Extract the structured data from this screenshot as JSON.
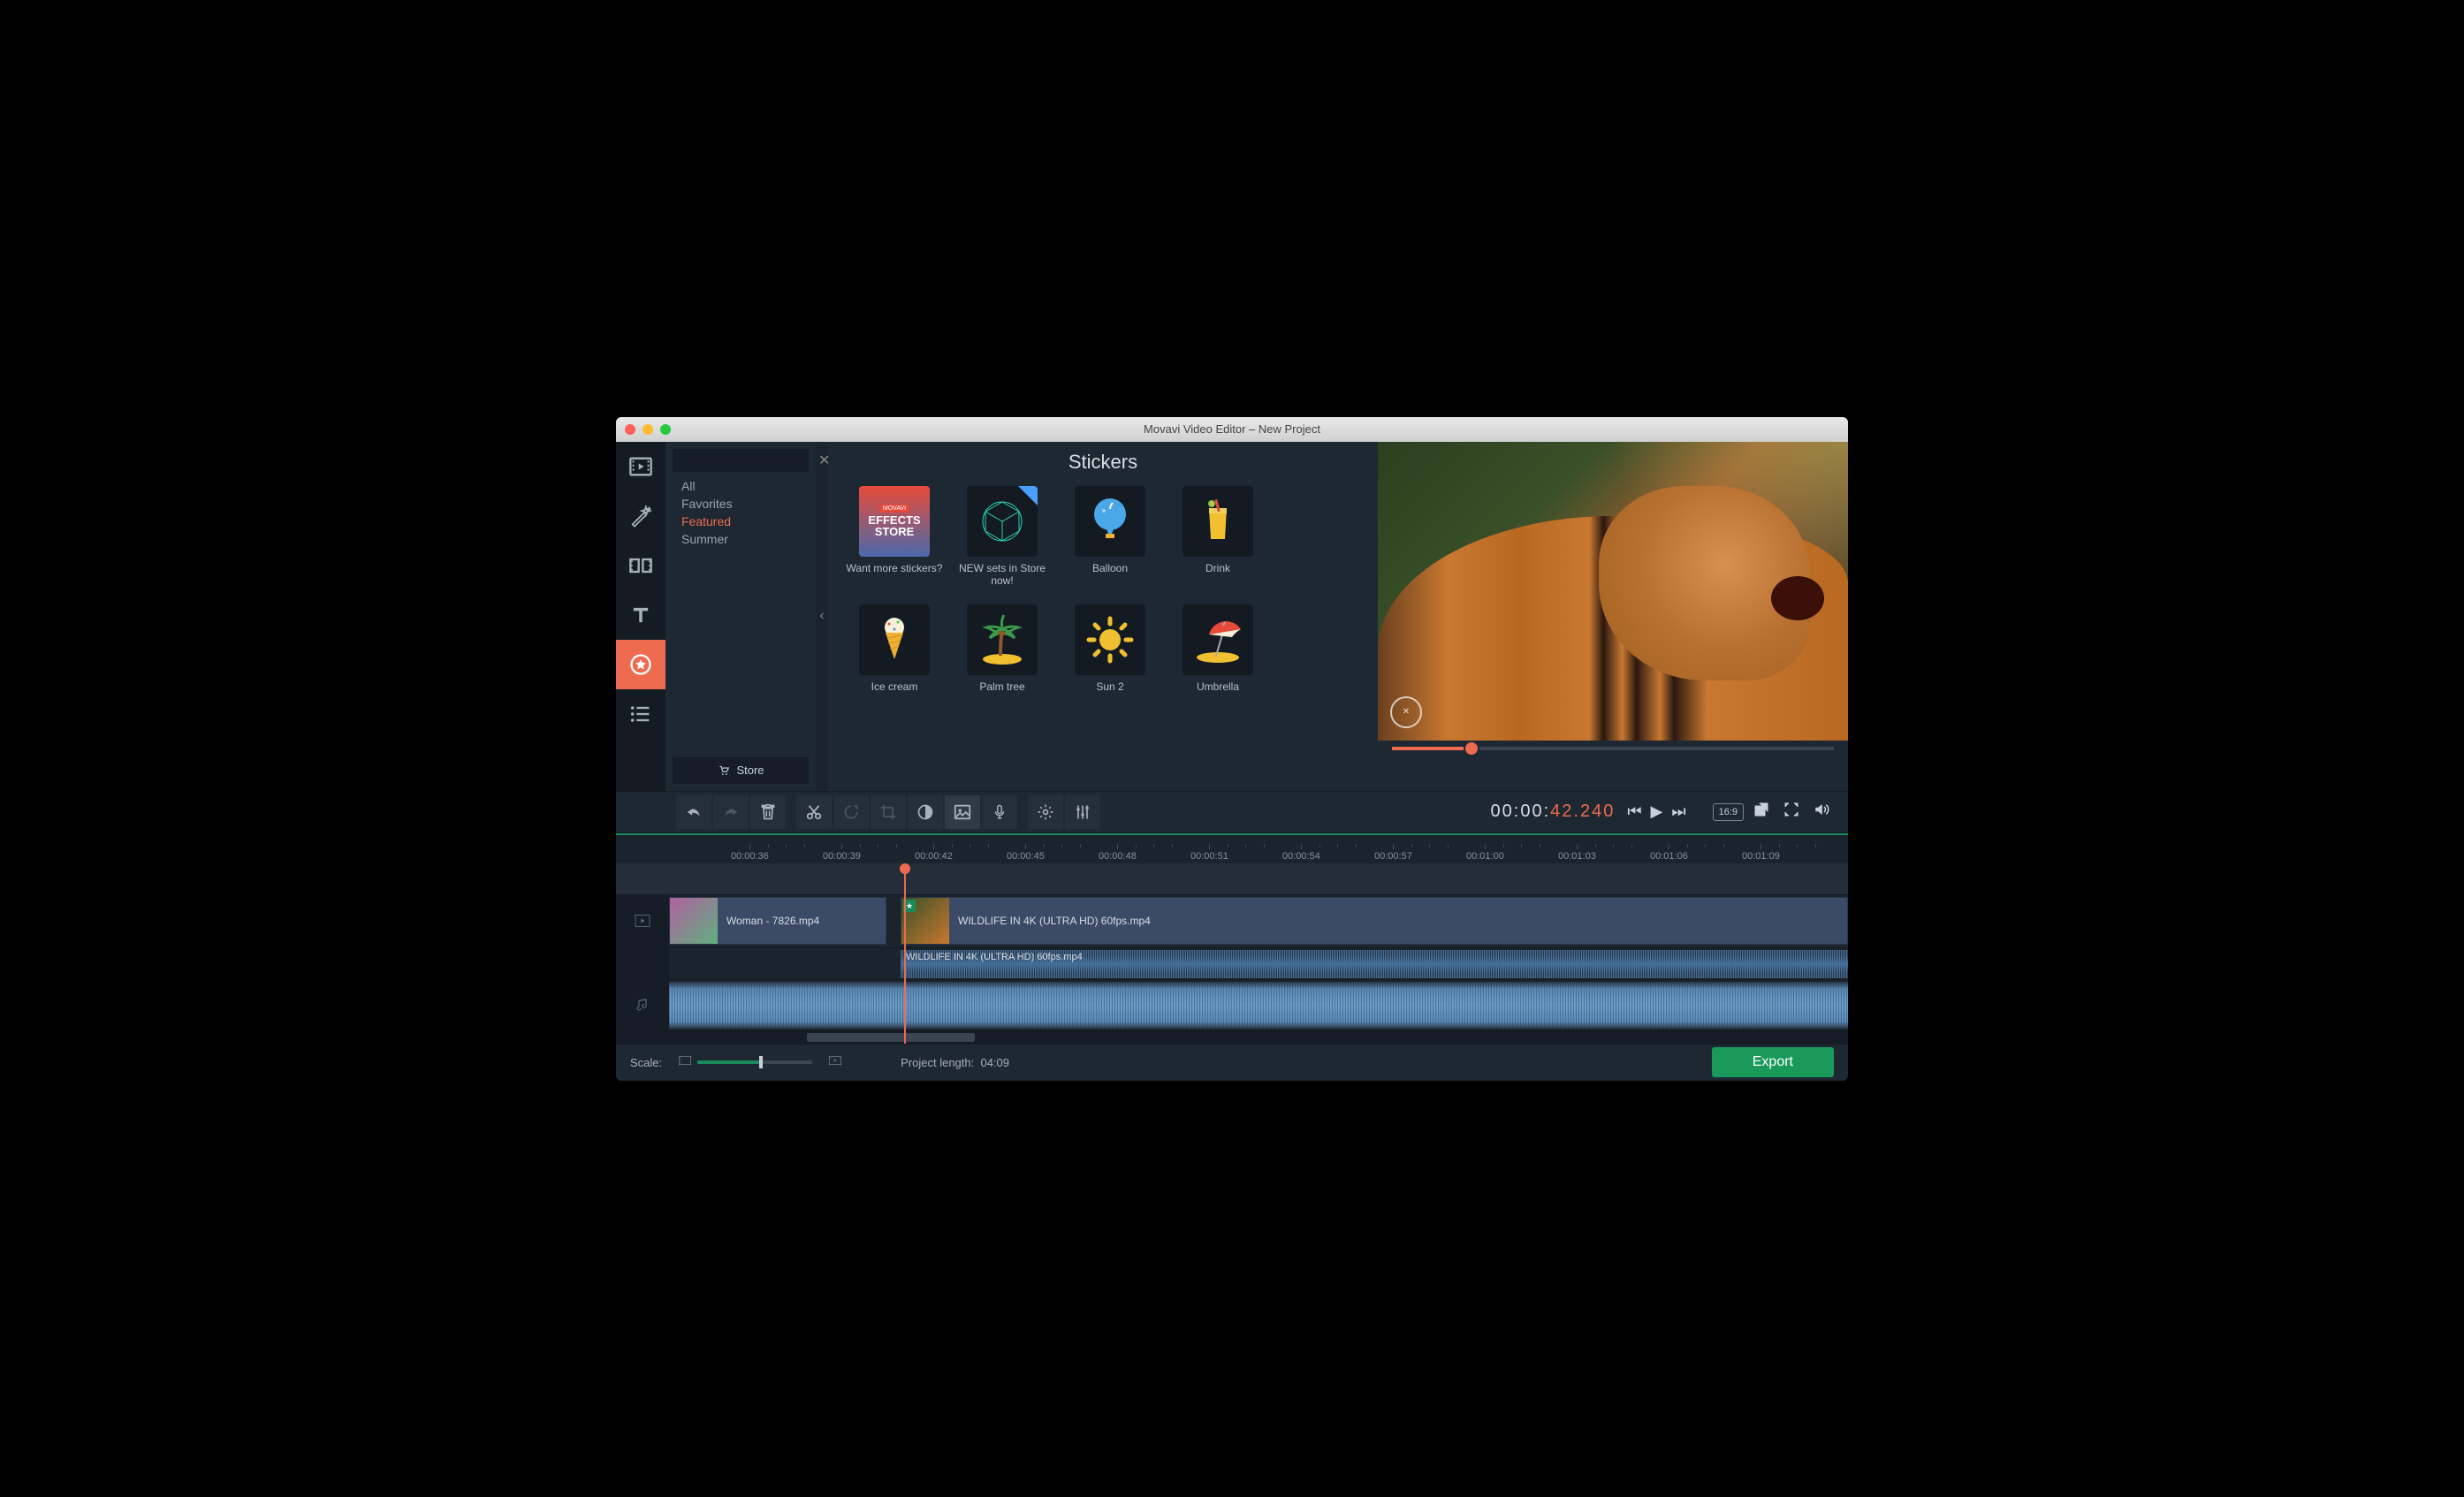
{
  "window_title": "Movavi Video Editor – New Project",
  "panel_title": "Stickers",
  "filter_categories": [
    "All",
    "Favorites",
    "Featured",
    "Summer"
  ],
  "filter_selected_index": 2,
  "store_button": "Store",
  "stickers": [
    {
      "label": "Want more stickers?",
      "icon": "effects-store"
    },
    {
      "label": "NEW sets in Store now!",
      "icon": "new-set",
      "badge": true
    },
    {
      "label": "Balloon",
      "icon": "balloon"
    },
    {
      "label": "Drink",
      "icon": "drink"
    },
    {
      "label": "Ice cream",
      "icon": "icecream"
    },
    {
      "label": "Palm tree",
      "icon": "palm"
    },
    {
      "label": "Sun 2",
      "icon": "sun"
    },
    {
      "label": "Umbrella",
      "icon": "umbrella"
    }
  ],
  "timecode_prefix": "00:00:",
  "timecode_suffix": "42.240",
  "aspect_ratio": "16:9",
  "ruler_marks": [
    "00:00:36",
    "00:00:39",
    "00:00:42",
    "00:00:45",
    "00:00:48",
    "00:00:51",
    "00:00:54",
    "00:00:57",
    "00:01:00",
    "00:01:03",
    "00:01:06",
    "00:01:09"
  ],
  "clips": {
    "clip1_label": "Woman - 7826.mp4",
    "clip2_label": "WILDLIFE IN 4K (ULTRA HD) 60fps.mp4",
    "audio_label": "WILDLIFE IN 4K (ULTRA HD) 60fps.mp4"
  },
  "footer": {
    "scale_label": "Scale:",
    "project_length_label": "Project length:",
    "project_length_value": "04:09",
    "export_label": "Export"
  }
}
